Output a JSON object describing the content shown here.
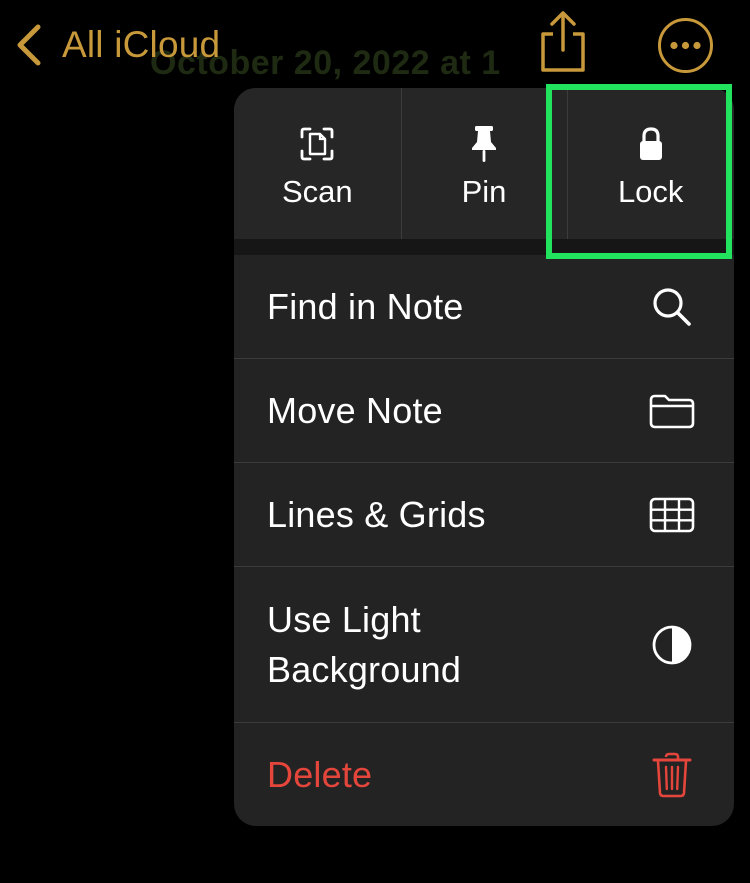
{
  "nav": {
    "back_label": "All iCloud",
    "back_icon": "chevron-left-icon",
    "share_icon": "share-icon",
    "more_icon": "ellipsis-circle-icon",
    "accent_color": "#c8993a"
  },
  "background_note": {
    "title_fragment": "October 20, 2022 at 1"
  },
  "menu": {
    "actions": [
      {
        "label": "Scan",
        "icon": "scan-document-icon"
      },
      {
        "label": "Pin",
        "icon": "pin-icon"
      },
      {
        "label": "Lock",
        "icon": "lock-icon"
      }
    ],
    "items": [
      {
        "label": "Find in Note",
        "icon": "search-icon"
      },
      {
        "label": "Move Note",
        "icon": "folder-icon"
      },
      {
        "label": "Lines & Grids",
        "icon": "grid-icon"
      },
      {
        "label": "Use Light Background",
        "icon": "contrast-icon"
      },
      {
        "label": "Delete",
        "icon": "trash-icon",
        "color": "#e5463c"
      }
    ]
  },
  "highlight_color": "#22e35e"
}
